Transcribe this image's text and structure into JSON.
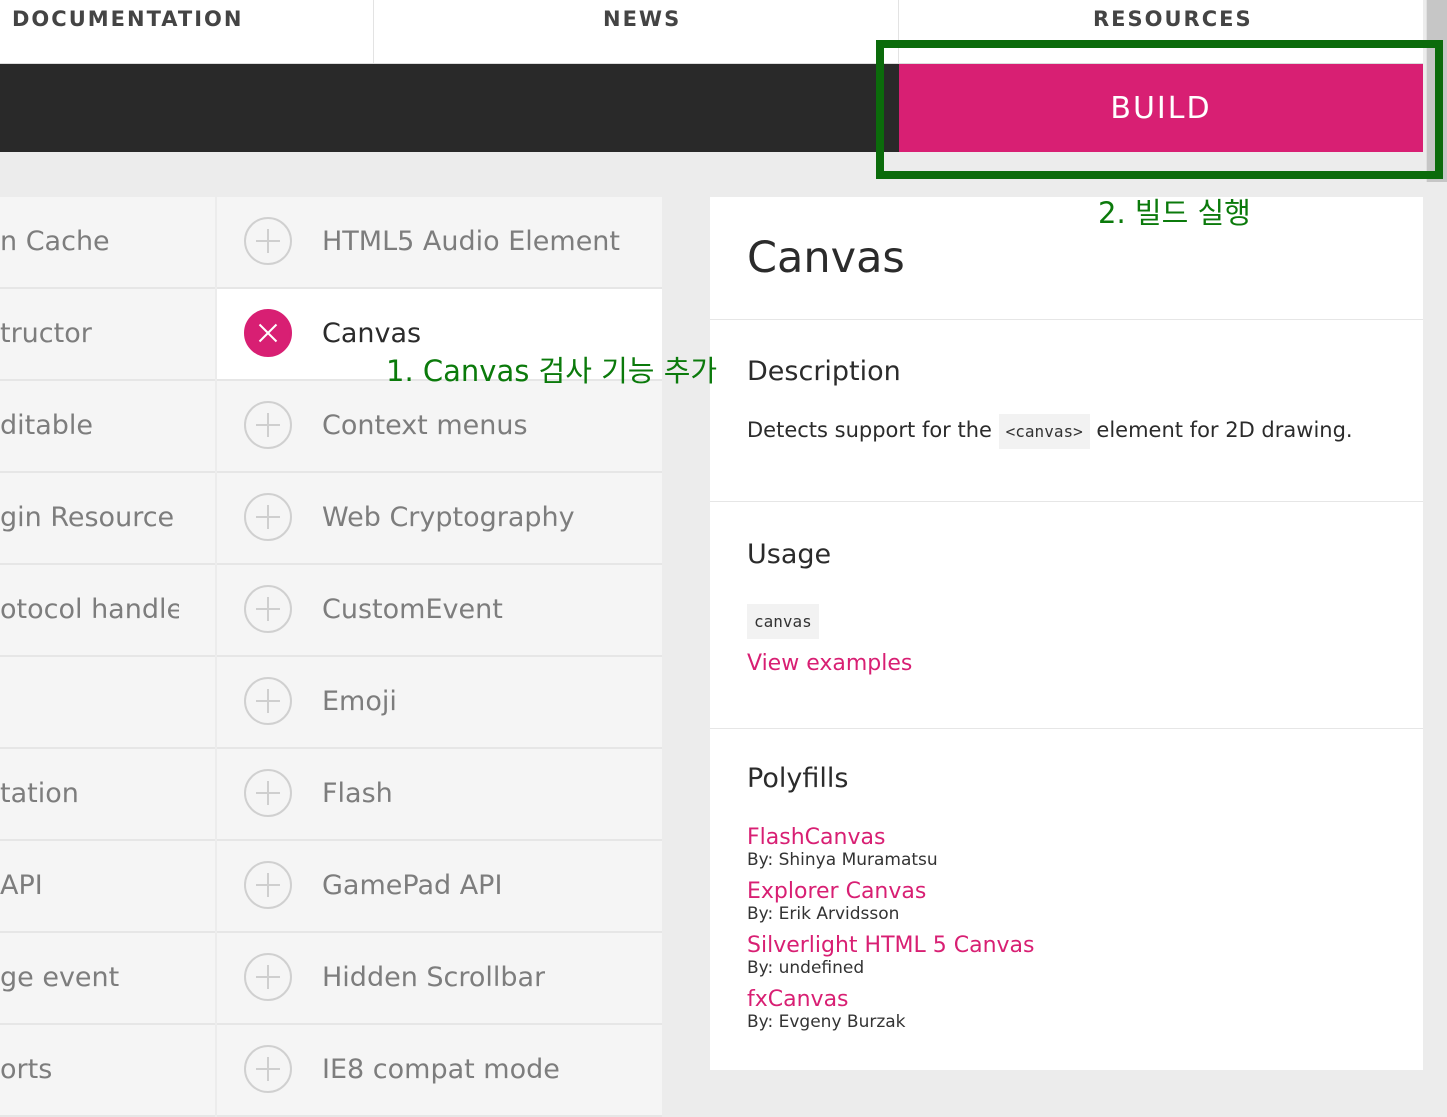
{
  "topnav": {
    "items": [
      "DOCUMENTATION",
      "NEWS",
      "RESOURCES"
    ]
  },
  "build": {
    "label": "BUILD"
  },
  "left_column": {
    "items": [
      "n Cache",
      "tructor",
      "ditable",
      "gin Resource …",
      "otocol handler",
      "",
      "tation",
      " API",
      "ge event",
      "orts"
    ]
  },
  "mid_column": {
    "items": [
      {
        "label": "HTML5 Audio Element",
        "selected": false
      },
      {
        "label": "Canvas",
        "selected": true
      },
      {
        "label": "Context menus",
        "selected": false
      },
      {
        "label": "Web Cryptography",
        "selected": false
      },
      {
        "label": "CustomEvent",
        "selected": false
      },
      {
        "label": "Emoji",
        "selected": false
      },
      {
        "label": "Flash",
        "selected": false
      },
      {
        "label": "GamePad API",
        "selected": false
      },
      {
        "label": "Hidden Scrollbar",
        "selected": false
      },
      {
        "label": "IE8 compat mode",
        "selected": false
      }
    ]
  },
  "detail": {
    "title": "Canvas",
    "description_heading": "Description",
    "description_before": "Detects support for the",
    "description_code": "<canvas>",
    "description_after": "element for 2D drawing.",
    "usage_heading": "Usage",
    "usage_code": "canvas",
    "view_examples": "View examples",
    "polyfills_heading": "Polyfills",
    "polyfills": [
      {
        "name": "FlashCanvas",
        "by": "By: Shinya Muramatsu"
      },
      {
        "name": "Explorer Canvas",
        "by": "By: Erik Arvidsson"
      },
      {
        "name": "Silverlight HTML 5 Canvas",
        "by": "By: undefined"
      },
      {
        "name": "fxCanvas",
        "by": "By: Evgeny Burzak"
      }
    ]
  },
  "annotations": {
    "step1": "1. Canvas 검사 기능 추가",
    "step2": "2. 빌드 실행",
    "color": "#0b6b0b"
  },
  "colors": {
    "accent": "#d81f73",
    "dark_bar": "#292929"
  }
}
